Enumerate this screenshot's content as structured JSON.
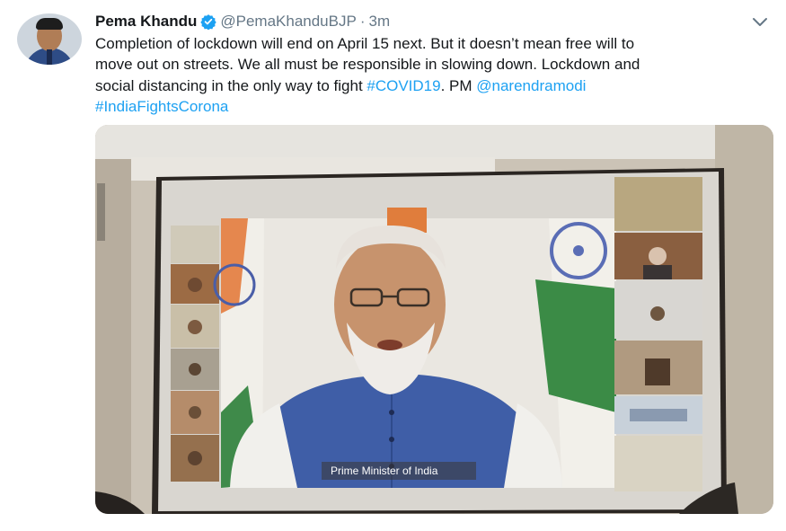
{
  "tweet": {
    "author_name": "Pema Khandu",
    "handle": "@PemaKhanduBJP",
    "separator": "·",
    "time": "3m",
    "text_line1": "Completion of lockdown will end on April 15 next. But it doesn’t mean free will to",
    "text_line2": "move out on streets. We all must be responsible in slowing down. Lockdown and",
    "text_line3_prefix": "social distancing in the only way to fight ",
    "hashtag_covid": "#COVID19",
    "text_line3_mid": ". PM ",
    "mention": "@narendramodi",
    "hashtag_india": "#IndiaFightsCorona"
  },
  "media": {
    "caption": "Prime Minister of India"
  },
  "icons": {
    "verified": "verified-badge-icon",
    "more": "chevron-down-icon"
  },
  "colors": {
    "link": "#1da1f2",
    "verified": "#1da1f2",
    "secondary_text": "#657786"
  }
}
